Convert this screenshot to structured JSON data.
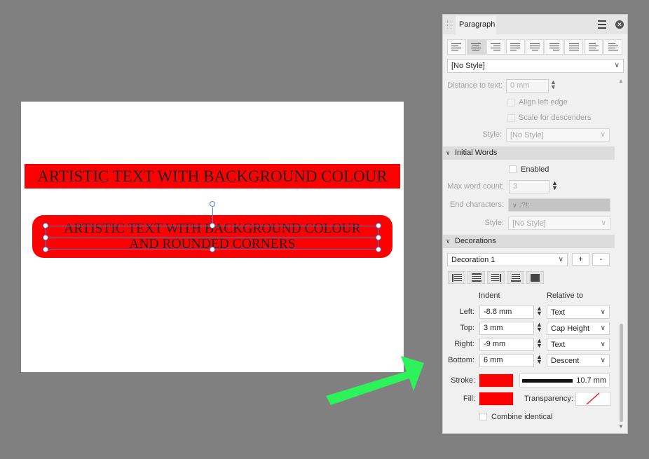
{
  "canvas": {
    "text1": "ARTISTIC TEXT WITH BACKGROUND COLOUR",
    "text2_line1": "ARTISTIC TEXT WITH BACKGROUND COLOUR",
    "text2_line2": "AND ROUNDED CORNERS",
    "highlight_color": "#ff0000"
  },
  "panel": {
    "title": "Paragraph",
    "menu_icon": "hamburger-icon",
    "close_icon": "close-icon",
    "alignment_buttons": [
      "align-left",
      "align-center",
      "align-right",
      "justify-left",
      "justify-center",
      "justify-right",
      "justify-all",
      "align-towards-spine",
      "align-away-from-spine"
    ],
    "active_alignment": "align-center",
    "style_dropdown": "[No Style]",
    "distance_to_text_label": "Distance to text:",
    "distance_to_text_value": "0 mm",
    "align_left_edge_label": "Align left edge",
    "scale_for_descenders_label": "Scale for descenders",
    "style_label": "Style:",
    "style_value": "[No Style]",
    "initial_words": {
      "title": "Initial Words",
      "enabled_label": "Enabled",
      "max_word_count_label": "Max word count:",
      "max_word_count_value": "3",
      "end_characters_label": "End characters:",
      "end_characters_value": ".?!:",
      "style_label": "Style:",
      "style_value": "[No Style]"
    },
    "decorations": {
      "title": "Decorations",
      "decoration_select": "Decoration 1",
      "add_label": "+",
      "remove_label": "-",
      "indent_header": "Indent",
      "relative_header": "Relative to",
      "rows": [
        {
          "label": "Left:",
          "value": "-8.8 mm",
          "relative": "Text"
        },
        {
          "label": "Top:",
          "value": "3 mm",
          "relative": "Cap Height"
        },
        {
          "label": "Right:",
          "value": "-9 mm",
          "relative": "Text"
        },
        {
          "label": "Bottom:",
          "value": "6 mm",
          "relative": "Descent"
        }
      ],
      "stroke_label": "Stroke:",
      "stroke_color": "#ff0000",
      "stroke_width": "10.7 mm",
      "fill_label": "Fill:",
      "fill_color": "#ff0000",
      "transparency_label": "Transparency:",
      "combine_identical_label": "Combine identical"
    }
  },
  "annotation": {
    "arrow_color": "#2ef25a"
  }
}
